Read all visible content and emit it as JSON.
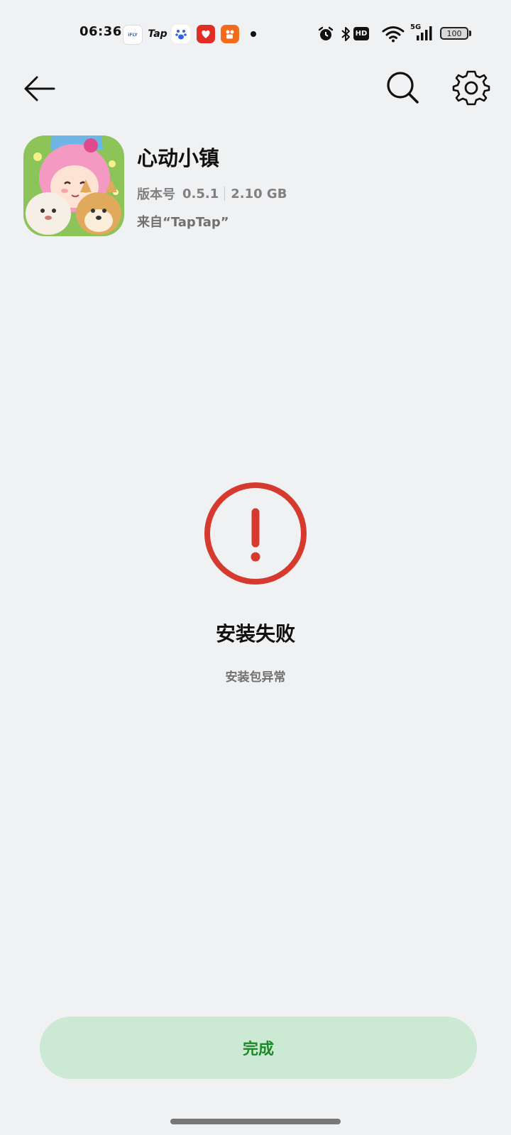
{
  "status_bar": {
    "time": "06:36",
    "notification_icons": [
      "ifly-icon",
      "tap-icon",
      "baidu-icon",
      "pinduoduo-icon",
      "kuaishou-icon"
    ],
    "ifly_label": "iFLY",
    "tap_label": "Tap",
    "hd_label": "HD",
    "network_label": "5G",
    "battery_level": "100"
  },
  "app": {
    "name": "心动小镇",
    "version_label": "版本号",
    "version": "0.5.1",
    "size": "2.10 GB",
    "source": "来自“TapTap”"
  },
  "result": {
    "title": "安装失败",
    "description": "安装包异常",
    "status_color": "#d63a2f"
  },
  "actions": {
    "done_label": "完成"
  },
  "colors": {
    "background": "#f0f1f3",
    "done_button_bg": "#cce9d3",
    "done_button_text": "#1d8a2a",
    "error_red": "#d63a2f"
  }
}
